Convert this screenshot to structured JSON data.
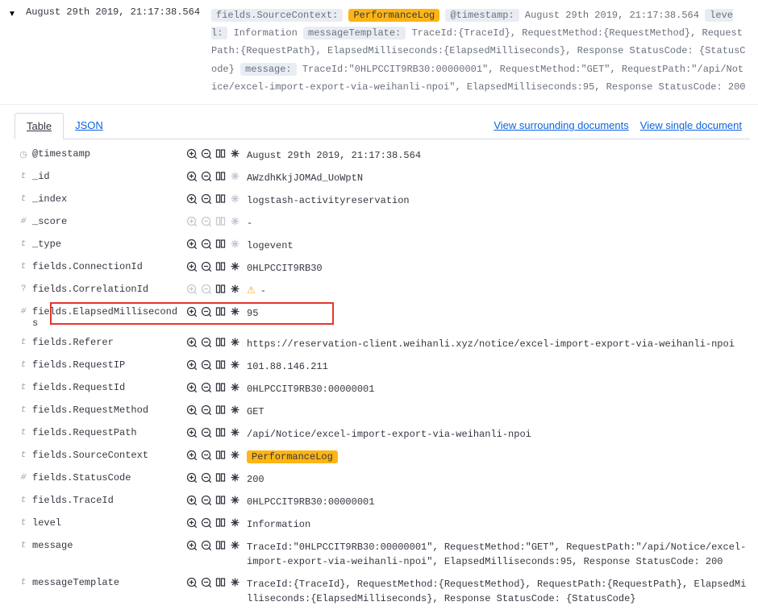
{
  "header": {
    "timestamp": "August 29th 2019, 21:17:38.564",
    "summary_keys": {
      "sourceContext": "fields.SourceContext:",
      "timestamp": "@timestamp:",
      "level": "level:",
      "messageTemplate": "messageTemplate:",
      "message": "message:"
    },
    "summary_values": {
      "sourceContext": "PerformanceLog",
      "timestamp": "August 29th 2019, 21:17:38.564",
      "level": "Information",
      "messageTemplate": "TraceId:{TraceId}, RequestMethod:{RequestMethod}, RequestPath:{RequestPath}, ElapsedMilliseconds:{ElapsedMilliseconds}, Response StatusCode: {StatusCode}",
      "message": "TraceId:\"0HLPCCIT9RB30:00000001\", RequestMethod:\"GET\", RequestPath:\"/api/Notice/excel-import-export-via-weihanli-npoi\", ElapsedMilliseconds:95, Response StatusCode: 200"
    }
  },
  "tabs": {
    "table": "Table",
    "json": "JSON"
  },
  "links": {
    "surrounding": "View surrounding documents",
    "single": "View single document"
  },
  "fields": [
    {
      "icon": "clock",
      "name": "@timestamp",
      "value": "August 29th 2019, 21:17:38.564",
      "disabledStar": false
    },
    {
      "icon": "t",
      "name": "_id",
      "value": "AWzdhKkjJOMAd_UoWptN",
      "disabledStar": true
    },
    {
      "icon": "t",
      "name": "_index",
      "value": "logstash-activityreservation",
      "disabledStar": true
    },
    {
      "icon": "#",
      "name": "_score",
      "value": " - ",
      "disabledAll": true
    },
    {
      "icon": "t",
      "name": "_type",
      "value": "logevent",
      "disabledStar": true
    },
    {
      "icon": "t",
      "name": "fields.ConnectionId",
      "value": "0HLPCCIT9RB30"
    },
    {
      "icon": "?",
      "name": "fields.CorrelationId",
      "value": "- ",
      "warn": true,
      "disabledPlusMinus": true
    },
    {
      "icon": "#",
      "name": "fields.ElapsedMilliseconds",
      "value": "95",
      "highlighted": true
    },
    {
      "icon": "t",
      "name": "fields.Referer",
      "value": "https://reservation-client.weihanli.xyz/notice/excel-import-export-via-weihanli-npoi"
    },
    {
      "icon": "t",
      "name": "fields.RequestIP",
      "value": "101.88.146.211"
    },
    {
      "icon": "t",
      "name": "fields.RequestId",
      "value": "0HLPCCIT9RB30:00000001"
    },
    {
      "icon": "t",
      "name": "fields.RequestMethod",
      "value": "GET"
    },
    {
      "icon": "t",
      "name": "fields.RequestPath",
      "value": "/api/Notice/excel-import-export-via-weihanli-npoi"
    },
    {
      "icon": "t",
      "name": "fields.SourceContext",
      "value": "PerformanceLog",
      "valHighlight": true
    },
    {
      "icon": "#",
      "name": "fields.StatusCode",
      "value": "200"
    },
    {
      "icon": "t",
      "name": "fields.TraceId",
      "value": "0HLPCCIT9RB30:00000001"
    },
    {
      "icon": "t",
      "name": "level",
      "value": "Information"
    },
    {
      "icon": "t",
      "name": "message",
      "value": "TraceId:\"0HLPCCIT9RB30:00000001\", RequestMethod:\"GET\", RequestPath:\"/api/Notice/excel-import-export-via-weihanli-npoi\", ElapsedMilliseconds:95, Response StatusCode: 200"
    },
    {
      "icon": "t",
      "name": "messageTemplate",
      "value": "TraceId:{TraceId}, RequestMethod:{RequestMethod}, RequestPath:{RequestPath}, ElapsedMilliseconds:{ElapsedMilliseconds}, Response StatusCode: {StatusCode}"
    }
  ]
}
